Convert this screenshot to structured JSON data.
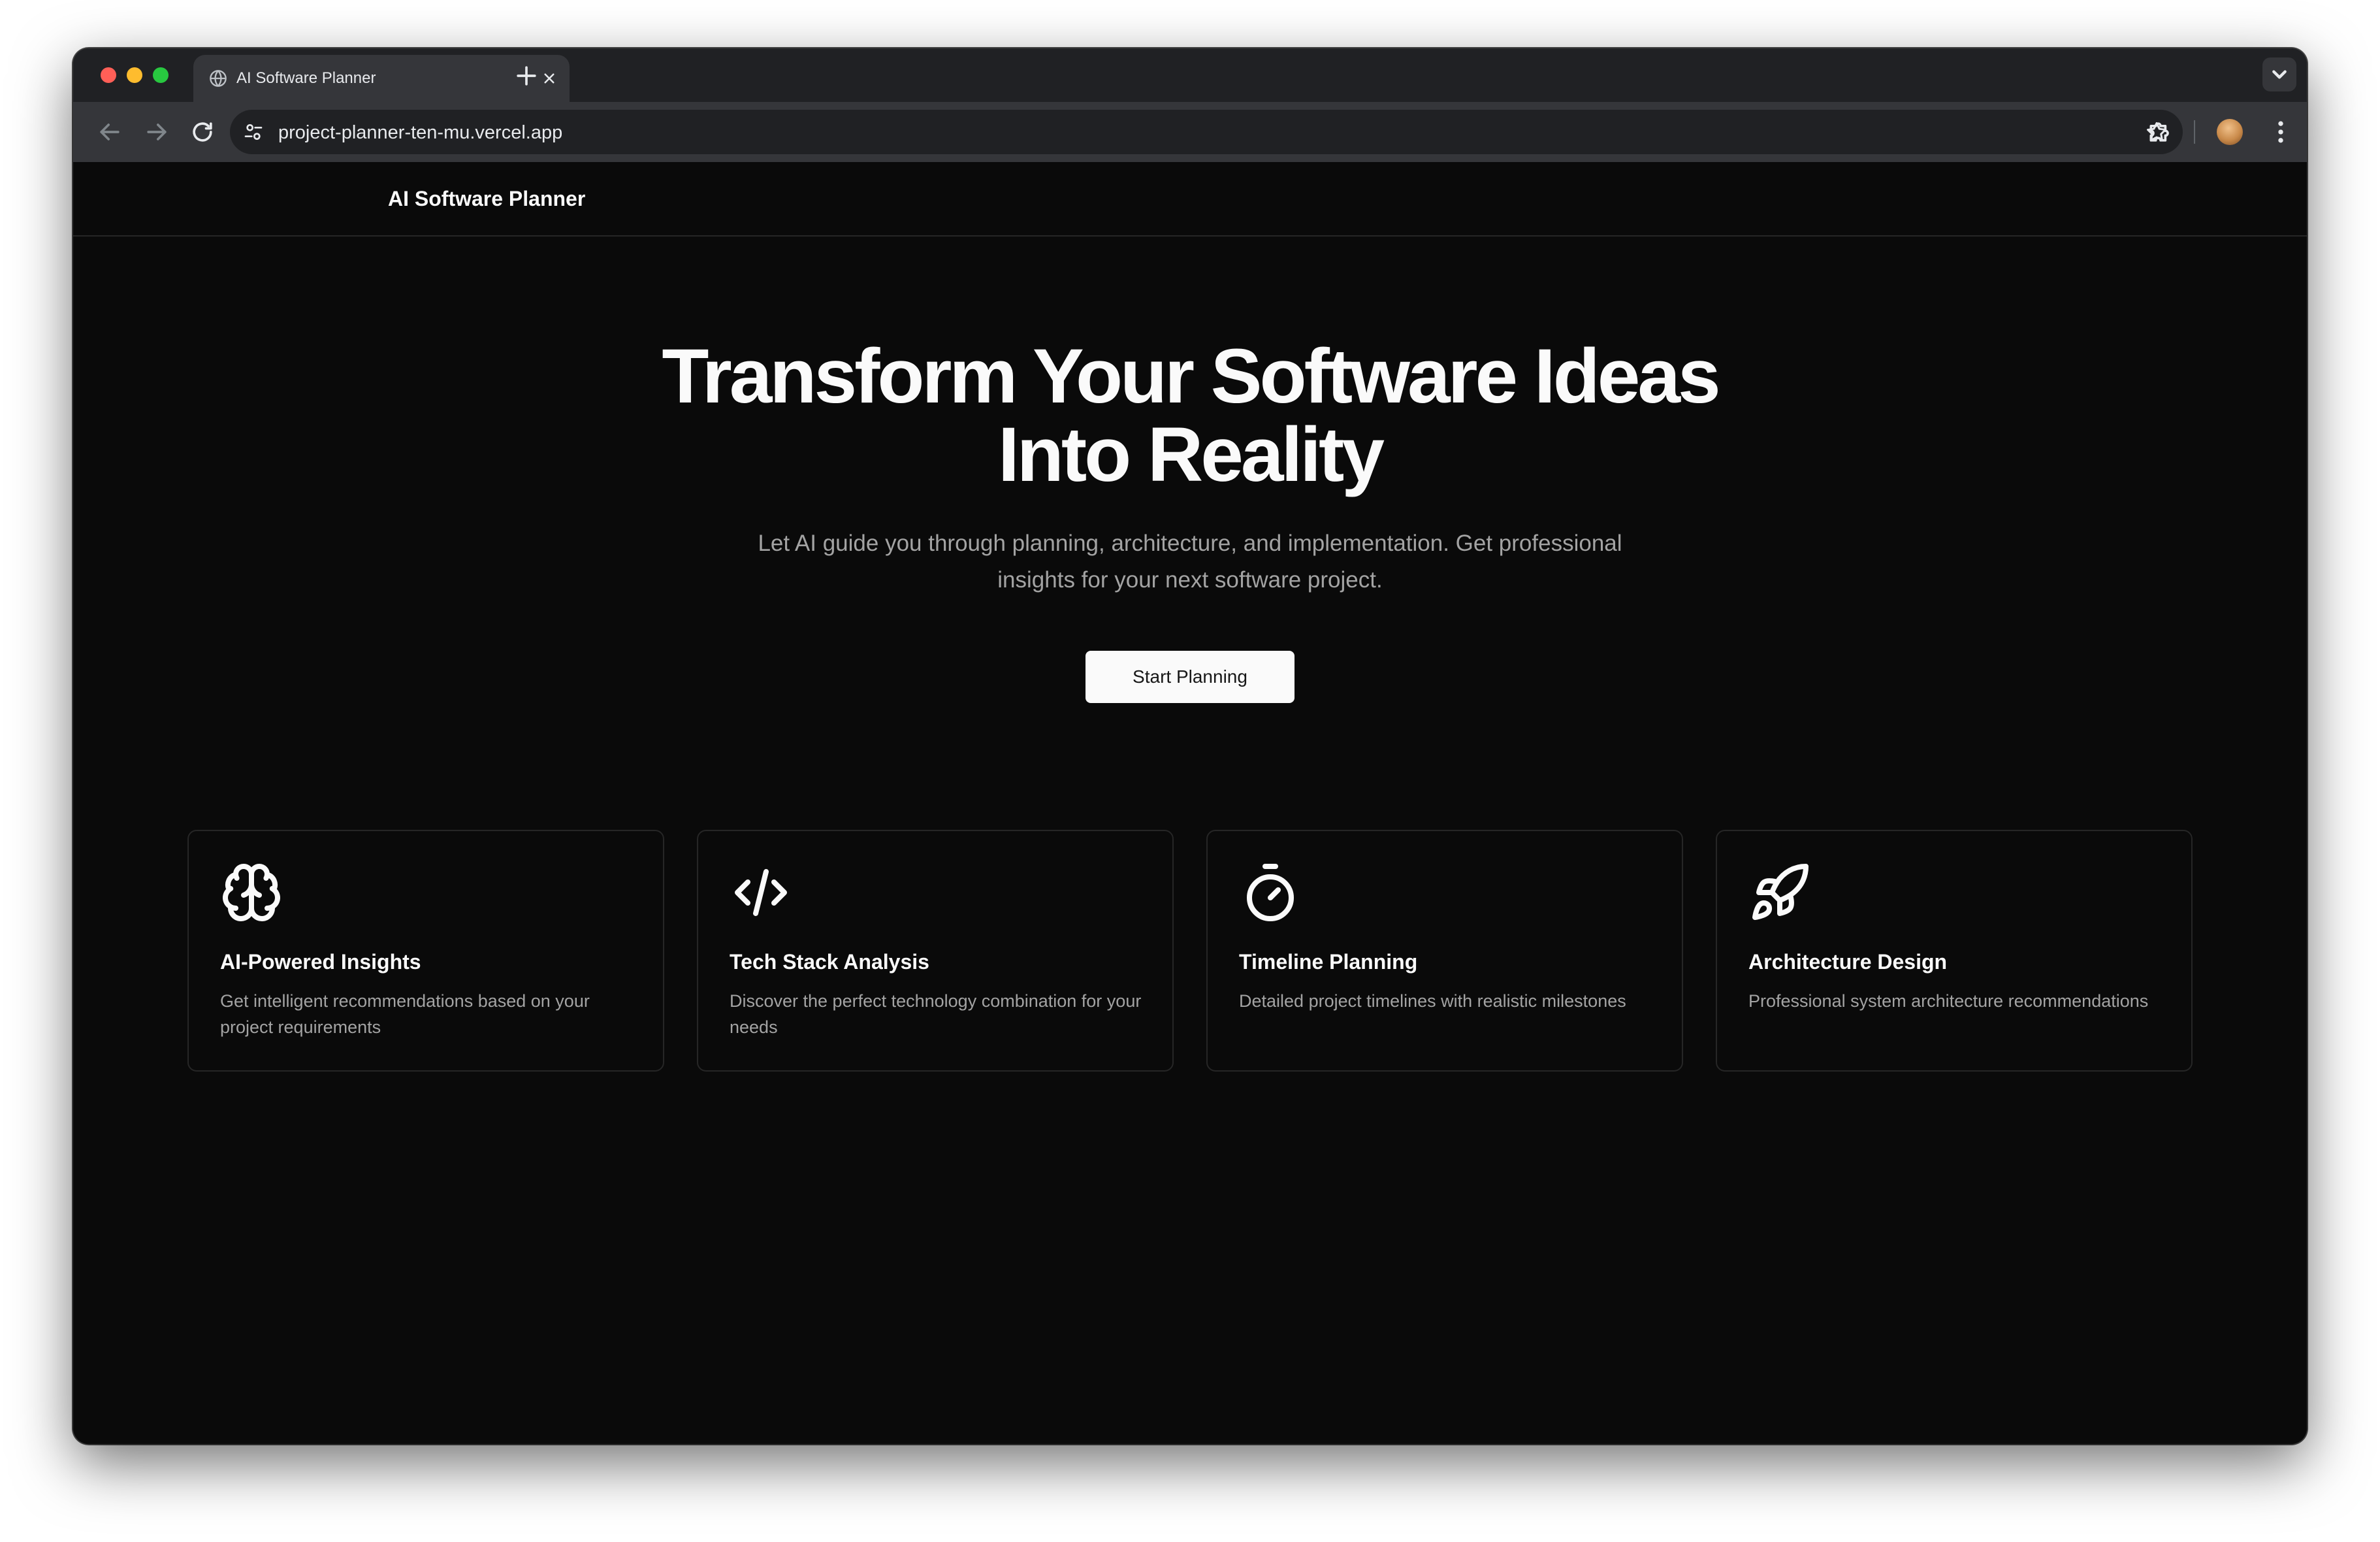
{
  "browser": {
    "tab": {
      "title": "AI Software Planner"
    },
    "address_bar": {
      "url": "project-planner-ten-mu.vercel.app"
    },
    "icons": {
      "back": "arrow-left-icon",
      "forward": "arrow-right-icon",
      "reload": "reload-icon",
      "site_info": "tune-icon",
      "bookmark": "star-icon",
      "extensions": "puzzle-icon",
      "menu": "kebab-menu-icon",
      "new_tab": "plus-icon",
      "tab_close": "close-icon",
      "tab_search": "chevron-down-icon"
    }
  },
  "site": {
    "brand": "AI Software Planner"
  },
  "hero": {
    "title_line1": "Transform Your Software Ideas",
    "title_line2": "Into Reality",
    "subtitle": "Let AI guide you through planning, architecture, and implementation. Get professional insights for your next software project.",
    "cta_label": "Start Planning"
  },
  "features": [
    {
      "icon": "brain-icon",
      "title": "AI-Powered Insights",
      "description": "Get intelligent recommendations based on your project requirements"
    },
    {
      "icon": "code-icon",
      "title": "Tech Stack Analysis",
      "description": "Discover the perfect technology combination for your needs"
    },
    {
      "icon": "timer-icon",
      "title": "Timeline Planning",
      "description": "Detailed project timelines with realistic milestones"
    },
    {
      "icon": "rocket-icon",
      "title": "Architecture Design",
      "description": "Professional system architecture recommendations"
    }
  ],
  "colors": {
    "page_background": "#0a0a0a",
    "foreground": "#fafafa",
    "muted_text": "#a3a3a3",
    "border": "#262626",
    "cta_background": "#fafafa",
    "cta_text": "#171717"
  }
}
